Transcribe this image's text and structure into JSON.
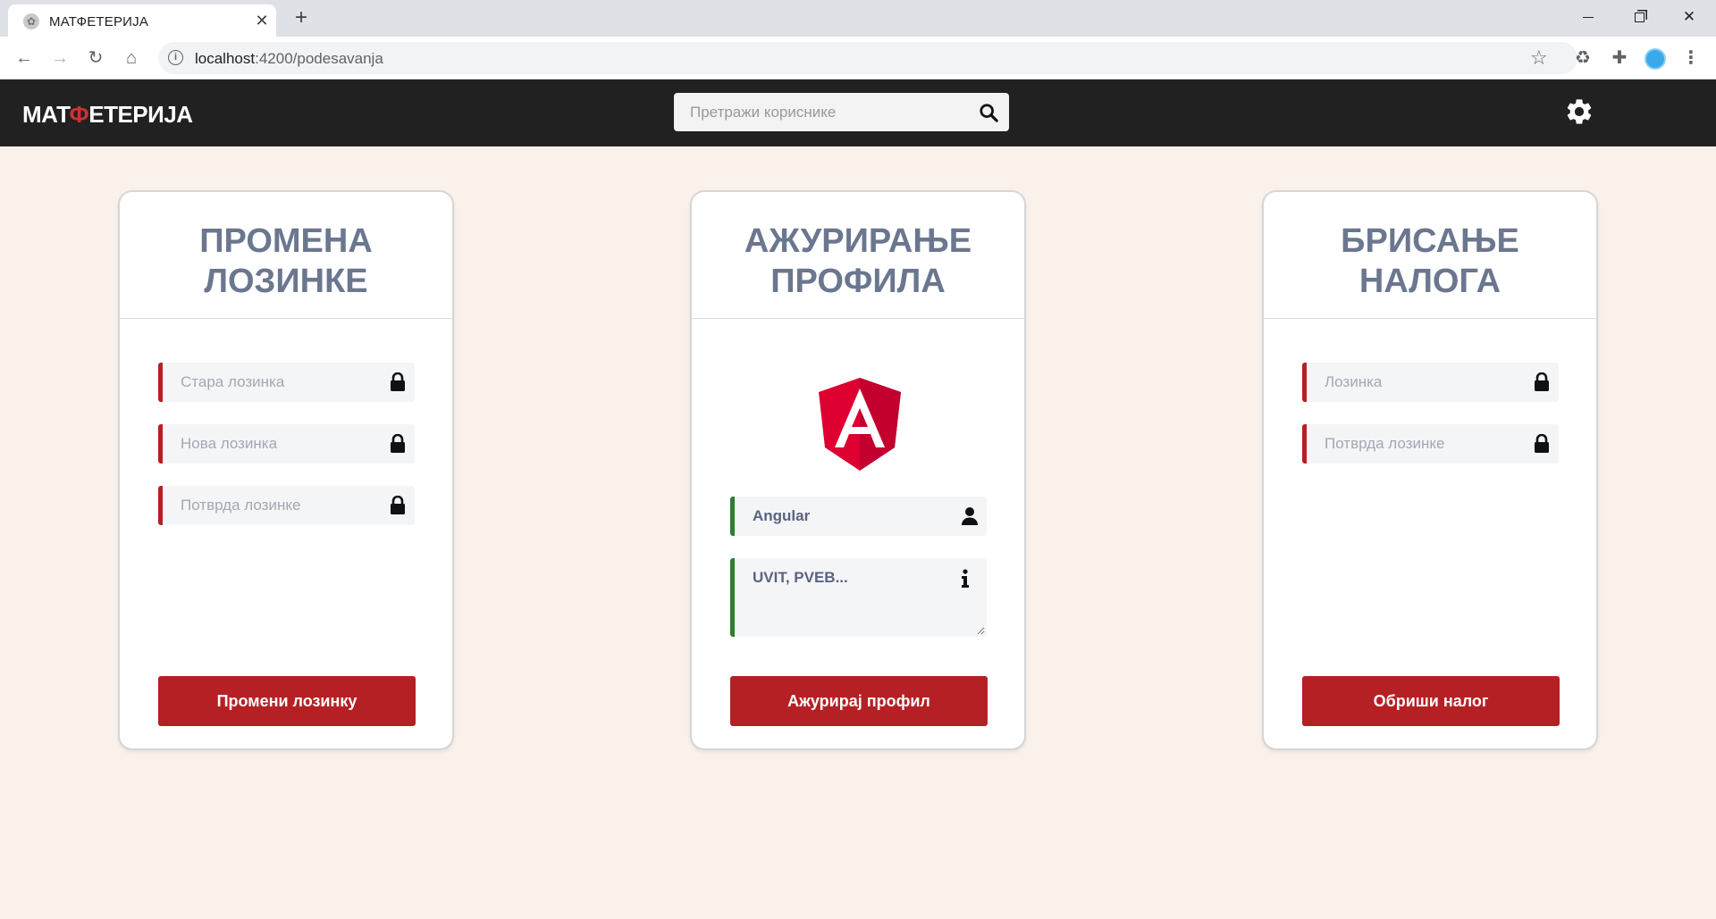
{
  "browser": {
    "tab_title": "МАТФЕТЕРИЈА",
    "url_host": "localhost",
    "url_path": ":4200/podesavanja"
  },
  "header": {
    "logo_part1": "МАТ",
    "logo_part2": "Ф",
    "logo_part3": "ЕТЕРИЈА",
    "search_placeholder": "Претражи кориснике"
  },
  "password_card": {
    "title": "ПРОМЕНА\nЛОЗИНКЕ",
    "old_password_placeholder": "Стара лозинка",
    "new_password_placeholder": "Нова лозинка",
    "confirm_password_placeholder": "Потврда лозинке",
    "button_label": "Промени лозинку"
  },
  "profile_card": {
    "title": "АЖУРИРАЊЕ\nПРОФИЛА",
    "name_value": "Angular",
    "bio_value": "UVIT, PVEB...",
    "button_label": "Ажурирај профил"
  },
  "delete_card": {
    "title": "БРИСАЊЕ\nНАЛОГА",
    "password_placeholder": "Лозинка",
    "confirm_password_placeholder": "Потврда лозинке",
    "button_label": "Обриши налог"
  },
  "colors": {
    "accent_red": "#b52024",
    "accent_green": "#2e7d32",
    "header_bg": "#212121",
    "page_bg": "#faf1eb",
    "title_color": "#6b778f"
  },
  "icons": {
    "lock": "lock-icon",
    "user": "user-icon",
    "info": "info-icon",
    "search": "search-icon",
    "settings": "gear-icon",
    "avatar": "angular-logo"
  }
}
